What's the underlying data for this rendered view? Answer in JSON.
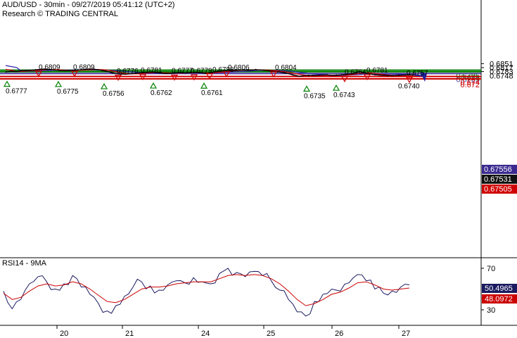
{
  "header": {
    "line1": "AUD/USD - 30min - 09/27/2019 05:41:12 (UTC+2)",
    "line2": "Research © TRADING CENTRAL"
  },
  "colors": {
    "price": "#000000",
    "ma_fast": "#d00000",
    "ma_slow": "#3020b0",
    "support_green": "#008000",
    "pivot_purple": "#4b3aa0",
    "resistance_red": "#d00000",
    "arrow": "#2020a0",
    "rsi": "#1a1a60",
    "rsi_ma": "#cc0000"
  },
  "chart_data": [
    {
      "type": "line",
      "title": "AUD/USD - 30min",
      "x_ticks": [
        "20",
        "21",
        "24",
        "25",
        "26",
        "27"
      ],
      "y_ticks": [
        "0.6851",
        "0.6817",
        "0.6783"
      ],
      "ylim": [
        0.6718,
        0.6858
      ],
      "grid": false,
      "close_series": [
        [
          "19",
          0.6779
        ],
        [
          "19",
          0.6786
        ],
        [
          "19",
          0.6783
        ],
        [
          "19",
          0.679
        ],
        [
          "19",
          0.6792
        ],
        [
          "19",
          0.6795
        ],
        [
          "19",
          0.68
        ],
        [
          "19",
          0.6804
        ],
        [
          "20",
          0.68
        ],
        [
          "20",
          0.6796
        ],
        [
          "20",
          0.6793
        ],
        [
          "20",
          0.679
        ],
        [
          "20",
          0.6792
        ],
        [
          "20",
          0.6795
        ],
        [
          "20",
          0.6798
        ],
        [
          "20",
          0.6802
        ],
        [
          "20",
          0.6805
        ],
        [
          "20",
          0.6798
        ],
        [
          "20",
          0.679
        ],
        [
          "20",
          0.678
        ],
        [
          "21",
          0.6768
        ],
        [
          "21",
          0.6762
        ],
        [
          "21",
          0.676
        ],
        [
          "21",
          0.6764
        ],
        [
          "21",
          0.6767
        ],
        [
          "21",
          0.6772
        ],
        [
          "21",
          0.6775
        ],
        [
          "21",
          0.6778
        ],
        [
          "21",
          0.6772
        ],
        [
          "21",
          0.6768
        ],
        [
          "21",
          0.6767
        ],
        [
          "21",
          0.677
        ],
        [
          "21",
          0.6773
        ],
        [
          "21",
          0.6771
        ],
        [
          "24",
          0.6774
        ],
        [
          "24",
          0.6776
        ],
        [
          "24",
          0.6772
        ],
        [
          "24",
          0.6766
        ],
        [
          "24",
          0.6775
        ],
        [
          "24",
          0.6784
        ],
        [
          "24",
          0.6789
        ],
        [
          "24",
          0.6792
        ],
        [
          "24",
          0.6794
        ],
        [
          "24",
          0.6795
        ],
        [
          "24",
          0.6797
        ],
        [
          "24",
          0.6796
        ],
        [
          "24",
          0.6799
        ],
        [
          "24",
          0.6796
        ],
        [
          "25",
          0.6792
        ],
        [
          "25",
          0.6786
        ],
        [
          "25",
          0.678
        ],
        [
          "25",
          0.6775
        ],
        [
          "25",
          0.6765
        ],
        [
          "25",
          0.6752
        ],
        [
          "25",
          0.6742
        ],
        [
          "25",
          0.6748
        ],
        [
          "25",
          0.675
        ],
        [
          "25",
          0.6749
        ],
        [
          "25",
          0.6752
        ],
        [
          "26",
          0.6754
        ],
        [
          "26",
          0.6748
        ],
        [
          "26",
          0.6752
        ],
        [
          "26",
          0.6755
        ],
        [
          "26",
          0.676
        ],
        [
          "26",
          0.6768
        ],
        [
          "26",
          0.6781
        ],
        [
          "26",
          0.6772
        ],
        [
          "26",
          0.6762
        ],
        [
          "26",
          0.6755
        ],
        [
          "26",
          0.6752
        ],
        [
          "26",
          0.675
        ],
        [
          "27",
          0.6748
        ],
        [
          "27",
          0.675
        ],
        [
          "27",
          0.6752
        ],
        [
          "27",
          0.6755
        ],
        [
          "27",
          0.6753
        ]
      ],
      "projection": {
        "from": 0.6755,
        "to": 0.672
      },
      "horizontal_levels": [
        {
          "label": "0.6795",
          "value": 0.6795,
          "color": "green"
        },
        {
          "label": "0.678",
          "value": 0.6781,
          "color": "green"
        },
        {
          "label": "0.6765",
          "value": 0.6766,
          "color": "purple"
        },
        {
          "label": "0.674",
          "value": 0.674,
          "color": "red"
        },
        {
          "label": "0.672",
          "value": 0.672,
          "color": "red"
        }
      ],
      "right_price_tags": [
        {
          "label": "0.67556",
          "value": 0.67556,
          "bg": "#3a2a90",
          "fg": "#ffffff"
        },
        {
          "label": "0.67531",
          "value": 0.67531,
          "bg": "#111111",
          "fg": "#ffffff"
        },
        {
          "label": "0.67505",
          "value": 0.67505,
          "bg": "#d00000",
          "fg": "#ffffff"
        }
      ],
      "partially_hidden_tick": "0.6748",
      "peaks": [
        {
          "label": "0.6809",
          "value": 0.6809,
          "x": "20"
        },
        {
          "label": "0.6809",
          "value": 0.6809,
          "x": "20"
        },
        {
          "label": "0.6776",
          "value": 0.6776,
          "x": "21"
        },
        {
          "label": "0.6781",
          "value": 0.6781,
          "x": "21"
        },
        {
          "label": "0.6777",
          "value": 0.6777,
          "x": "24"
        },
        {
          "label": "0.6779",
          "value": 0.6779,
          "x": "24"
        },
        {
          "label": "0.6788",
          "value": 0.6788,
          "x": "24"
        },
        {
          "label": "0.6806",
          "value": 0.6806,
          "x": "24"
        },
        {
          "label": "0.6804",
          "value": 0.6804,
          "x": "25"
        },
        {
          "label": "0.6764",
          "value": 0.6764,
          "x": "26"
        },
        {
          "label": "0.6781",
          "value": 0.6781,
          "x": "26"
        },
        {
          "label": "0.6757",
          "value": 0.6757,
          "x": "27"
        }
      ],
      "troughs": [
        {
          "label": "0.6777",
          "value": 0.6777,
          "x": "19"
        },
        {
          "label": "0.6775",
          "value": 0.6775,
          "x": "20"
        },
        {
          "label": "0.6756",
          "value": 0.6756,
          "x": "21"
        },
        {
          "label": "0.6762",
          "value": 0.6762,
          "x": "21"
        },
        {
          "label": "0.6761",
          "value": 0.6761,
          "x": "24"
        },
        {
          "label": "0.6735",
          "value": 0.6735,
          "x": "25"
        },
        {
          "label": "0.6743",
          "value": 0.6743,
          "x": "26"
        },
        {
          "label": "0.6740",
          "value": 0.674,
          "x": "27"
        }
      ]
    },
    {
      "type": "line",
      "title": "RSI14 - 9MA",
      "y_ticks": [
        "70",
        "30"
      ],
      "ylim": [
        20,
        80
      ],
      "series": [
        {
          "name": "RSI14",
          "values": [
            48,
            31,
            40,
            55,
            62,
            57,
            50,
            55,
            63,
            52,
            45,
            36,
            29,
            34,
            43,
            52,
            57,
            53,
            49,
            54,
            58,
            56,
            61,
            57,
            55,
            65,
            70,
            66,
            62,
            67,
            63,
            58,
            49,
            40,
            28,
            24,
            38,
            45,
            50,
            48,
            56,
            64,
            58,
            50,
            46,
            48,
            52,
            54
          ]
        },
        {
          "name": "9MA",
          "values": [
            46,
            40,
            42,
            48,
            53,
            55,
            53,
            54,
            57,
            55,
            50,
            44,
            38,
            37,
            40,
            45,
            50,
            52,
            52,
            53,
            55,
            56,
            57,
            57,
            57,
            60,
            63,
            64,
            63,
            64,
            63,
            60,
            55,
            48,
            40,
            34,
            36,
            40,
            45,
            47,
            51,
            56,
            57,
            54,
            50,
            49,
            50,
            51
          ]
        }
      ],
      "right_value_tags": [
        {
          "label": "50.4965",
          "value": 50.4965,
          "bg": "#1a1a60",
          "fg": "#ffffff"
        },
        {
          "label": "48.0972",
          "value": 48.0972,
          "bg": "#cc0000",
          "fg": "#ffffff"
        }
      ]
    }
  ]
}
